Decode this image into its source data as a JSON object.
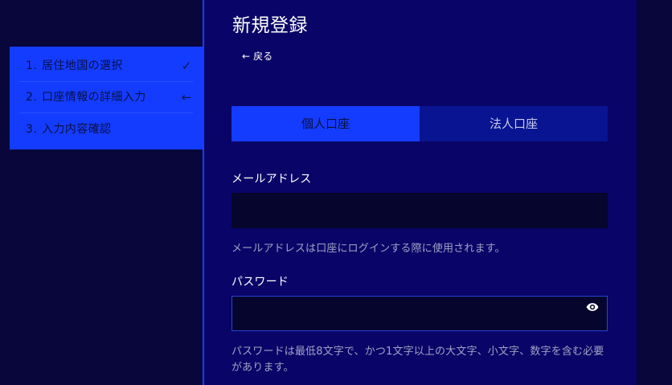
{
  "page": {
    "title": "新規登録",
    "back_label": "戻る"
  },
  "sidebar": {
    "steps": [
      {
        "number": "1.",
        "label": "居住地国の選択",
        "status_icon": "check-icon",
        "status_symbol": "✓"
      },
      {
        "number": "2.",
        "label": "口座情報の詳細入力",
        "status_icon": "arrow-left-icon",
        "status_symbol": "←"
      },
      {
        "number": "3.",
        "label": "入力内容確認",
        "status_icon": "",
        "status_symbol": ""
      }
    ]
  },
  "account_tabs": [
    {
      "label": "個人口座",
      "state": "selected"
    },
    {
      "label": "法人口座",
      "state": "unselected"
    }
  ],
  "form": {
    "email": {
      "label": "メールアドレス",
      "value": "",
      "placeholder": "",
      "help": "メールアドレスは口座にログインする際に使用されます。"
    },
    "password": {
      "label": "パスワード",
      "value": "",
      "placeholder": "",
      "icon": "eye-icon",
      "help": "パスワードは最低8文字で、かつ1文字以上の大文字、小文字、数字を含む必要があります。"
    }
  },
  "colors": {
    "background": "#08063a",
    "panel": "#090467",
    "accent": "#143cff",
    "inactive_tab": "#081491",
    "input": "#05052d",
    "border": "#2646d7",
    "muted_text": "#9fa3c4"
  }
}
